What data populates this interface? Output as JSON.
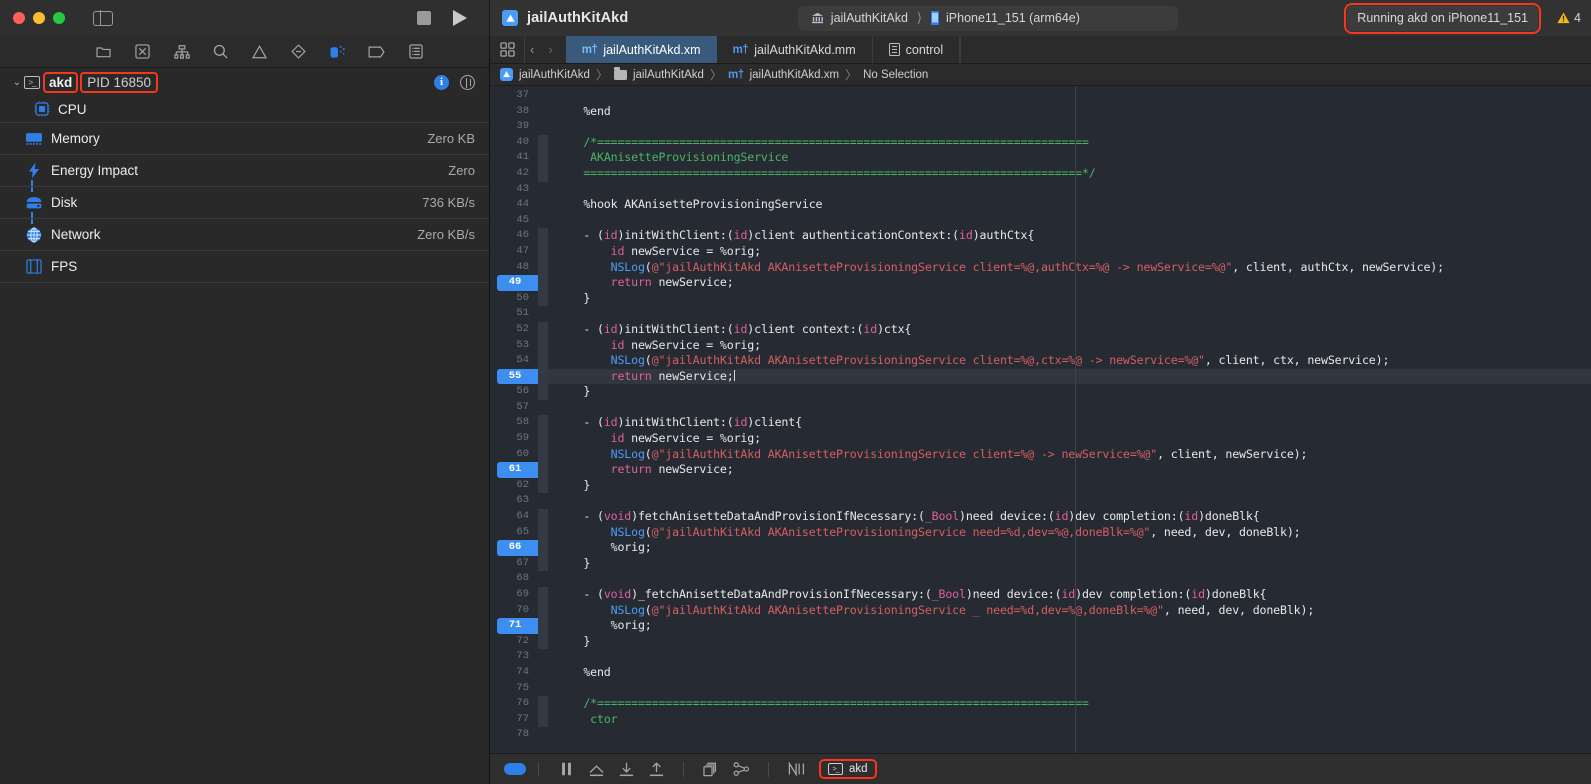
{
  "titlebar": {
    "window_controls": [
      "close",
      "minimize",
      "zoom"
    ],
    "sidebar_toggle_icon": "sidebar-toggle-icon",
    "stop_icon": "stop-icon",
    "run_icon": "run-icon",
    "project_title": "jailAuthKitAkd",
    "scheme": "jailAuthKitAkd",
    "destination": "iPhone11_151 (arm64e)",
    "status": "Running akd on iPhone11_151",
    "warning_count": "4"
  },
  "navigator": {
    "toolbar_icons": [
      "project-navigator-icon",
      "source-control-navigator-icon",
      "symbol-navigator-icon",
      "find-navigator-icon",
      "issue-navigator-icon",
      "test-navigator-icon",
      "debug-navigator-icon",
      "breakpoint-navigator-icon",
      "report-navigator-icon"
    ],
    "process": {
      "name": "akd",
      "pid": "PID 16850",
      "disclosure": "⌄",
      "info_label": "i"
    },
    "cpu_label": "CPU",
    "gauges": [
      {
        "icon": "memory-icon",
        "label": "Memory",
        "value": "Zero KB",
        "tick": false
      },
      {
        "icon": "energy-icon",
        "label": "Energy Impact",
        "value": "Zero",
        "tick": true
      },
      {
        "icon": "disk-icon",
        "label": "Disk",
        "value": "736 KB/s",
        "tick": true
      },
      {
        "icon": "network-icon",
        "label": "Network",
        "value": "Zero KB/s",
        "tick": false
      },
      {
        "icon": "fps-icon",
        "label": "FPS",
        "value": "",
        "tick": false
      }
    ]
  },
  "editor": {
    "back_arrow": "‹",
    "forward_arrow": "›",
    "tabs": [
      {
        "label": "jailAuthKitAkd.xm",
        "icon": "objc-file-icon",
        "selected": true
      },
      {
        "label": "jailAuthKitAkd.mm",
        "icon": "objc-file-icon",
        "selected": false
      },
      {
        "label": "control",
        "icon": "text-file-icon",
        "selected": false
      }
    ],
    "breadcrumb": [
      "jailAuthKitAkd",
      "jailAuthKitAkd",
      "jailAuthKitAkd.xm",
      "No Selection"
    ],
    "breadcrumb_separator": "〉"
  },
  "code": {
    "first_line": 37,
    "cursor_line": 55,
    "breakpoint_lines": [
      49,
      55,
      61,
      66,
      71
    ],
    "fold_lines": [
      40,
      41,
      42,
      46,
      47,
      48,
      49,
      50,
      52,
      53,
      54,
      55,
      56,
      58,
      59,
      60,
      61,
      62,
      64,
      65,
      66,
      67,
      69,
      70,
      71,
      72,
      76,
      77
    ],
    "lines": [
      {
        "n": 37,
        "html": ""
      },
      {
        "n": 38,
        "html": "    %end"
      },
      {
        "n": 39,
        "html": ""
      },
      {
        "n": 40,
        "html": "    <span class='cmt'>/*========================================================================</span>"
      },
      {
        "n": 41,
        "html": "    <span class='cmt'> AKAnisetteProvisioningService</span>"
      },
      {
        "n": 42,
        "html": "    <span class='cmt'>=========================================================================*/</span>"
      },
      {
        "n": 43,
        "html": ""
      },
      {
        "n": 44,
        "html": "    %hook AKAnisetteProvisioningService"
      },
      {
        "n": 45,
        "html": ""
      },
      {
        "n": 46,
        "html": "    - (<span class='kw'>id</span>)initWithClient:(<span class='kw'>id</span>)client authenticationContext:(<span class='kw'>id</span>)authCtx{"
      },
      {
        "n": 47,
        "html": "        <span class='kw'>id</span> newService = %orig;"
      },
      {
        "n": 48,
        "html": "        <span class='fn'>NSLog</span>(<span class='str'>@\"jailAuthKitAkd AKAnisetteProvisioningService client=%@,authCtx=%@ -&gt; newService=%@\"</span>, client, authCtx, newService);"
      },
      {
        "n": 49,
        "html": "        <span class='kw'>return</span> newService;"
      },
      {
        "n": 50,
        "html": "    }"
      },
      {
        "n": 51,
        "html": ""
      },
      {
        "n": 52,
        "html": "    - (<span class='kw'>id</span>)initWithClient:(<span class='kw'>id</span>)client context:(<span class='kw'>id</span>)ctx{"
      },
      {
        "n": 53,
        "html": "        <span class='kw'>id</span> newService = %orig;"
      },
      {
        "n": 54,
        "html": "        <span class='fn'>NSLog</span>(<span class='str'>@\"jailAuthKitAkd AKAnisetteProvisioningService client=%@,ctx=%@ -&gt; newService=%@\"</span>, client, ctx, newService);"
      },
      {
        "n": 55,
        "html": "        <span class='kw'>return</span> newService;<span class='cursor'></span>"
      },
      {
        "n": 56,
        "html": "    }"
      },
      {
        "n": 57,
        "html": ""
      },
      {
        "n": 58,
        "html": "    - (<span class='kw'>id</span>)initWithClient:(<span class='kw'>id</span>)client{"
      },
      {
        "n": 59,
        "html": "        <span class='kw'>id</span> newService = %orig;"
      },
      {
        "n": 60,
        "html": "        <span class='fn'>NSLog</span>(<span class='str'>@\"jailAuthKitAkd AKAnisetteProvisioningService client=%@ -&gt; newService=%@\"</span>, client, newService);"
      },
      {
        "n": 61,
        "html": "        <span class='kw'>return</span> newService;"
      },
      {
        "n": 62,
        "html": "    }"
      },
      {
        "n": 63,
        "html": ""
      },
      {
        "n": 64,
        "html": "    - (<span class='kw'>void</span>)fetchAnisetteDataAndProvisionIfNecessary:(<span class='kw'>_Bool</span>)need device:(<span class='kw'>id</span>)dev completion:(<span class='kw'>id</span>)doneBlk{"
      },
      {
        "n": 65,
        "html": "        <span class='fn'>NSLog</span>(<span class='str'>@\"jailAuthKitAkd AKAnisetteProvisioningService need=%d,dev=%@,doneBlk=%@\"</span>, need, dev, doneBlk);"
      },
      {
        "n": 66,
        "html": "        %orig;"
      },
      {
        "n": 67,
        "html": "    }"
      },
      {
        "n": 68,
        "html": ""
      },
      {
        "n": 69,
        "html": "    - (<span class='kw'>void</span>)_fetchAnisetteDataAndProvisionIfNecessary:(<span class='kw'>_Bool</span>)need device:(<span class='kw'>id</span>)dev completion:(<span class='kw'>id</span>)doneBlk{"
      },
      {
        "n": 70,
        "html": "        <span class='fn'>NSLog</span>(<span class='str'>@\"jailAuthKitAkd AKAnisetteProvisioningService _ need=%d,dev=%@,doneBlk=%@\"</span>, need, dev, doneBlk);"
      },
      {
        "n": 71,
        "html": "        %orig;"
      },
      {
        "n": 72,
        "html": "    }"
      },
      {
        "n": 73,
        "html": ""
      },
      {
        "n": 74,
        "html": "    %end"
      },
      {
        "n": 75,
        "html": ""
      },
      {
        "n": 76,
        "html": "    <span class='cmt'>/*========================================================================</span>"
      },
      {
        "n": 77,
        "html": "    <span class='cmt'> ctor</span>"
      },
      {
        "n": 78,
        "html": ""
      }
    ]
  },
  "debugbar": {
    "toggle_icon": "debug-area-toggle-icon",
    "buttons": [
      "pause-icon",
      "step-over-icon",
      "step-into-icon",
      "step-out-icon",
      "debug-view-hierarchy-icon",
      "debug-memory-graph-icon",
      "debug-workflow-icon"
    ],
    "process_chip": "akd"
  },
  "colors": {
    "accent": "#2f7fe8",
    "highlight_outline": "#f6361f",
    "editor_bg": "#262b33",
    "comment": "#4bb462",
    "keyword": "#e05fa0",
    "string": "#d55e62",
    "function": "#4d9bf0"
  }
}
